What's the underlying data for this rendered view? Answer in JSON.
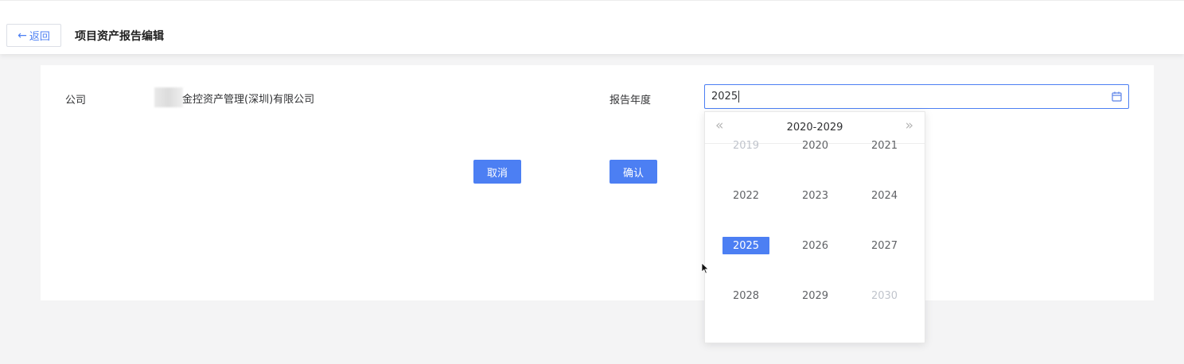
{
  "header": {
    "back_label": "返回",
    "title": "项目资产报告编辑"
  },
  "form": {
    "company_label": "公司",
    "company_value": "金控资产管理(深圳)有限公司",
    "year_label": "报告年度",
    "year_value": "2025"
  },
  "actions": {
    "cancel_label": "取消",
    "confirm_label": "确认"
  },
  "picker": {
    "decade_label": "2020-2029",
    "prev_label": "«",
    "next_label": "»",
    "years": [
      {
        "label": "2019",
        "state": "muted"
      },
      {
        "label": "2020",
        "state": "normal"
      },
      {
        "label": "2021",
        "state": "normal"
      },
      {
        "label": "2022",
        "state": "normal"
      },
      {
        "label": "2023",
        "state": "normal"
      },
      {
        "label": "2024",
        "state": "normal"
      },
      {
        "label": "2025",
        "state": "selected"
      },
      {
        "label": "2026",
        "state": "normal"
      },
      {
        "label": "2027",
        "state": "normal"
      },
      {
        "label": "2028",
        "state": "normal"
      },
      {
        "label": "2029",
        "state": "normal"
      },
      {
        "label": "2030",
        "state": "muted"
      }
    ]
  },
  "colors": {
    "accent": "#4c7ff3",
    "muted_text": "#c0c4cc",
    "text": "#606266"
  }
}
